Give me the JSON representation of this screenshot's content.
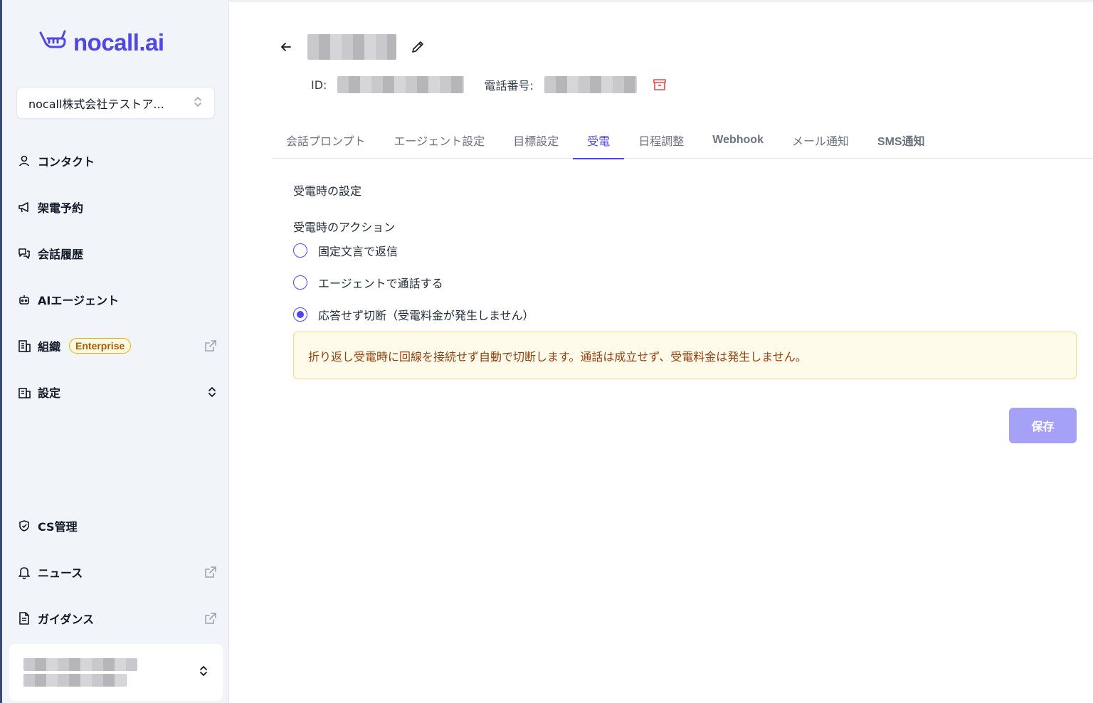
{
  "sidebar": {
    "logo_text": "nocall.ai",
    "org_select": {
      "value": "nocall株式会社テストア..."
    },
    "items": [
      {
        "label": "コンタクト",
        "icon": "user-icon"
      },
      {
        "label": "架電予約",
        "icon": "megaphone-icon"
      },
      {
        "label": "会話履歴",
        "icon": "chat-icon"
      },
      {
        "label": "AIエージェント",
        "icon": "robot-icon"
      },
      {
        "label": "組織",
        "icon": "building-icon",
        "badge": "Enterprise",
        "external": true
      },
      {
        "label": "設定",
        "icon": "building-icon",
        "expandable": true
      },
      {
        "label": "CS管理",
        "icon": "shield-icon"
      },
      {
        "label": "ニュース",
        "icon": "bell-icon",
        "external": true
      },
      {
        "label": "ガイダンス",
        "icon": "document-icon",
        "external": true
      }
    ]
  },
  "header": {
    "id_label": "ID:",
    "phone_label": "電話番号:"
  },
  "tabs": [
    {
      "label": "会話プロンプト",
      "active": false
    },
    {
      "label": "エージェント設定",
      "active": false
    },
    {
      "label": "目標設定",
      "active": false
    },
    {
      "label": "受電",
      "active": true
    },
    {
      "label": "日程調整",
      "active": false
    },
    {
      "label": "Webhook",
      "active": false
    },
    {
      "label": "メール通知",
      "active": false
    },
    {
      "label": "SMS通知",
      "active": false
    }
  ],
  "content": {
    "section_title": "受電時の設定",
    "action_label": "受電時のアクション",
    "options": [
      {
        "label": "固定文言で返信",
        "checked": false
      },
      {
        "label": "エージェントで通話する",
        "checked": false
      },
      {
        "label": "応答せず切断（受電料金が発生しません）",
        "checked": true
      }
    ],
    "notice": "折り返し受電時に回線を接続せず自動で切断します。通話は成立せず、受電料金は発生しません。",
    "save_label": "保存"
  },
  "colors": {
    "accent": "#4f46e5",
    "notice_bg": "#fffbeb",
    "notice_text": "#92400e",
    "archive_icon": "#ef4444",
    "save_button": "#a5a1f7"
  }
}
